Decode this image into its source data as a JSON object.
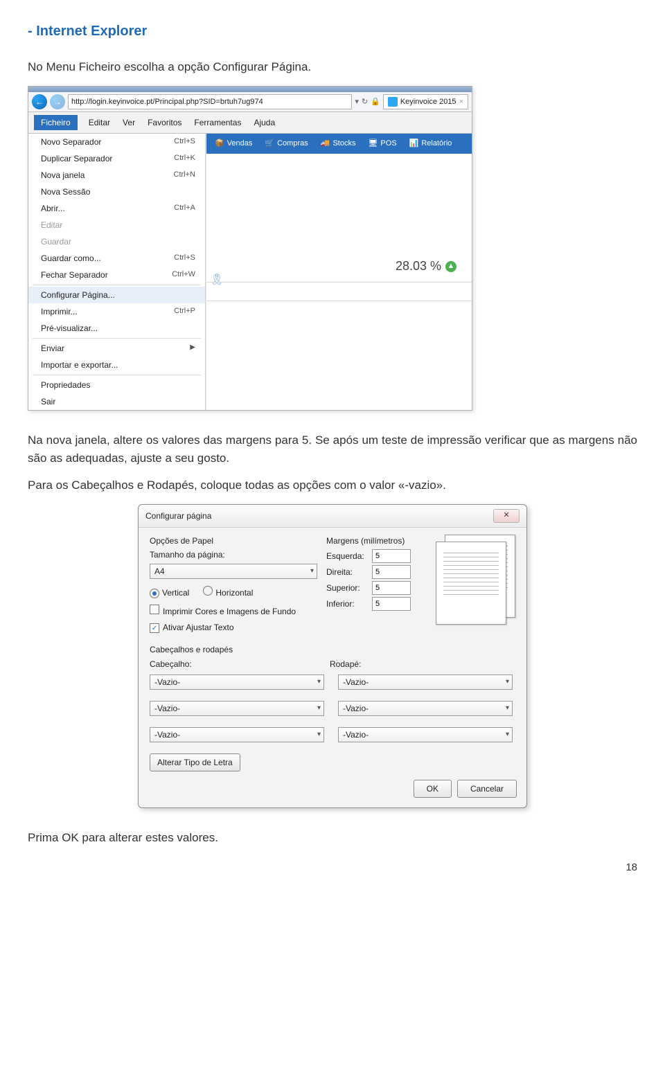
{
  "heading": "- Internet Explorer",
  "para1": "No Menu Ficheiro escolha a opção Configurar Página.",
  "para2": "Na nova janela, altere os valores das margens para 5. Se após um teste de impressão verificar que as margens não são as adequadas, ajuste a seu gosto.",
  "para3": "Para os Cabeçalhos e Rodapés, coloque todas as opções com o valor «-vazio».",
  "para4": "Prima OK para alterar estes valores.",
  "page_num": "18",
  "ie": {
    "url": "http://login.keyinvoice.pt/Principal.php?SID=brtuh7ug974",
    "tab": "Keyinvoice 2015",
    "refresh_glyph": "↻",
    "search_arrow": "▾",
    "lock_glyph": "🔒",
    "menubar": [
      "Ficheiro",
      "Editar",
      "Ver",
      "Favoritos",
      "Ferramentas",
      "Ajuda"
    ],
    "file_menu": [
      {
        "label": "Novo Separador",
        "short": "Ctrl+S"
      },
      {
        "label": "Duplicar Separador",
        "short": "Ctrl+K"
      },
      {
        "label": "Nova janela",
        "short": "Ctrl+N"
      },
      {
        "label": "Nova Sessão",
        "short": ""
      },
      {
        "label": "Abrir...",
        "short": "Ctrl+A"
      },
      {
        "label": "Editar",
        "short": "",
        "disabled": true
      },
      {
        "label": "Guardar",
        "short": "",
        "disabled": true
      },
      {
        "label": "Guardar como...",
        "short": "Ctrl+S"
      },
      {
        "label": "Fechar Separador",
        "short": "Ctrl+W"
      },
      {
        "sep": true
      },
      {
        "label": "Configurar Página...",
        "short": "",
        "highlight": true
      },
      {
        "label": "Imprimir...",
        "short": "Ctrl+P"
      },
      {
        "label": "Pré-visualizar...",
        "short": ""
      },
      {
        "sep": true
      },
      {
        "label": "Enviar",
        "short": "",
        "arrow": true
      },
      {
        "label": "Importar e exportar...",
        "short": ""
      },
      {
        "sep": true
      },
      {
        "label": "Propriedades",
        "short": ""
      },
      {
        "label": "Sair",
        "short": ""
      }
    ],
    "brandbar": [
      {
        "icon": "📦",
        "label": "Vendas"
      },
      {
        "icon": "🛒",
        "label": "Compras"
      },
      {
        "icon": "🚚",
        "label": "Stocks"
      },
      {
        "icon": "🖥",
        "label": "POS"
      },
      {
        "icon": "📊",
        "label": "Relatório"
      }
    ],
    "percent": "28.03 %"
  },
  "dlg": {
    "title": "Configurar página",
    "close_glyph": "✕",
    "paper_section": "Opções de Papel",
    "page_size_label": "Tamanho da página:",
    "page_size": "A4",
    "orient_v": "Vertical",
    "orient_h": "Horizontal",
    "print_bg": "Imprimir Cores e Imagens de Fundo",
    "shrink": "Ativar Ajustar Texto",
    "margins_section": "Margens (milímetros)",
    "m_left_l": "Esquerda:",
    "m_left": "5",
    "m_right_l": "Direita:",
    "m_right": "5",
    "m_top_l": "Superior:",
    "m_top": "5",
    "m_bot_l": "Inferior:",
    "m_bot": "5",
    "hf_section": "Cabeçalhos e rodapés",
    "header_l": "Cabeçalho:",
    "footer_l": "Rodapé:",
    "empty": "-Vazio-",
    "font_btn": "Alterar Tipo de Letra",
    "ok": "OK",
    "cancel": "Cancelar"
  }
}
